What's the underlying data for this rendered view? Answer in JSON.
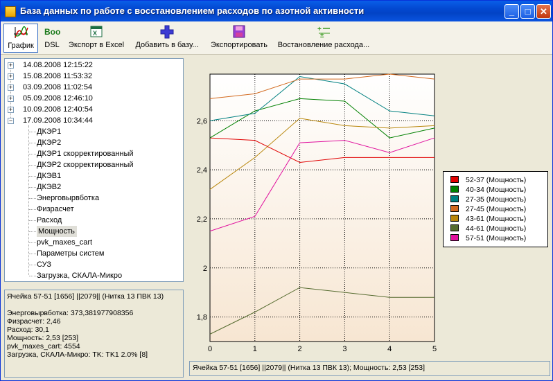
{
  "window": {
    "title": "База данных по работе с восстановлением расходов по азотной активности"
  },
  "toolbar": {
    "items": [
      {
        "label": "График"
      },
      {
        "label": "DSL",
        "icon_text": "Boo"
      },
      {
        "label": "Экспорт в Excel"
      },
      {
        "label": "Добавить в базу..."
      },
      {
        "label": "Экспортировать"
      },
      {
        "label": "Востановление расхода..."
      }
    ]
  },
  "tree": {
    "dates": [
      "14.08.2008 12:15:22",
      "15.08.2008 11:53:32",
      "03.09.2008 11:02:54",
      "05.09.2008 12:46:10",
      "10.09.2008 12:40:54",
      "17.09.2008 10:34:44"
    ],
    "children": [
      "ДКЭР1",
      "ДКЭР2",
      "ДКЭР1 скорректированный",
      "ДКЭР2 скорректированный",
      "ДКЭВ1",
      "ДКЭВ2",
      "Энерговырвботка",
      "Физрасчет",
      "Расход",
      "Мощность",
      "pvk_maxes_cart",
      "Параметры систем",
      "СУЗ",
      "Загрузка, СКАЛА-Микро"
    ],
    "selected": "Мощность"
  },
  "info": {
    "lines": [
      "Ячейка 57-51 [1656] ||2079|| (Нитка 13 ПВК 13)",
      "",
      "Энерговырвботка: 373,381977908356",
      "Физрасчет: 2,46",
      "Расход: 30,1",
      "Мощность: 2,53 [253]",
      "pvk_maxes_cart: 4554",
      "Загрузка, СКАЛА-Микро: TK: TK1 2.0% [8]"
    ]
  },
  "statusbar": {
    "text": "Ячейка 57-51 [1656] ||2079|| (Нитка 13 ПВК 13); Мощность: 2,53 [253]"
  },
  "chart_data": {
    "type": "line",
    "x": [
      0,
      1,
      2,
      3,
      4,
      5
    ],
    "xlim": [
      0,
      5
    ],
    "ylim": [
      1.7,
      2.79
    ],
    "yticks": [
      1.8,
      2,
      2.2,
      2.4,
      2.6
    ],
    "ytick_labels": [
      "1,8",
      "2",
      "2,2",
      "2,4",
      "2,6"
    ],
    "xtick_labels": [
      "0",
      "1",
      "2",
      "3",
      "4",
      "5"
    ],
    "grid": true,
    "legend_position": "right",
    "series": [
      {
        "name": "52-37 (Мощность)",
        "color": "#e00000",
        "values": [
          2.53,
          2.52,
          2.43,
          2.45,
          2.45,
          2.45
        ]
      },
      {
        "name": "40-34 (Мощность)",
        "color": "#008000",
        "values": [
          2.53,
          2.64,
          2.69,
          2.68,
          2.53,
          2.57
        ]
      },
      {
        "name": "27-35 (Мощность)",
        "color": "#008080",
        "values": [
          2.6,
          2.63,
          2.78,
          2.75,
          2.64,
          2.62
        ]
      },
      {
        "name": "27-45 (Мощность)",
        "color": "#d2691e",
        "values": [
          2.69,
          2.71,
          2.77,
          2.77,
          2.79,
          2.77
        ]
      },
      {
        "name": "43-61 (Мощность)",
        "color": "#b8860b",
        "values": [
          2.32,
          2.45,
          2.61,
          2.58,
          2.57,
          2.58
        ]
      },
      {
        "name": "44-61 (Мощность)",
        "color": "#556b2f",
        "values": [
          1.73,
          1.82,
          1.92,
          1.9,
          1.88,
          1.88
        ]
      },
      {
        "name": "57-51 (Мощность)",
        "color": "#e0119e",
        "values": [
          2.15,
          2.21,
          2.51,
          2.52,
          2.47,
          2.53
        ]
      }
    ]
  }
}
